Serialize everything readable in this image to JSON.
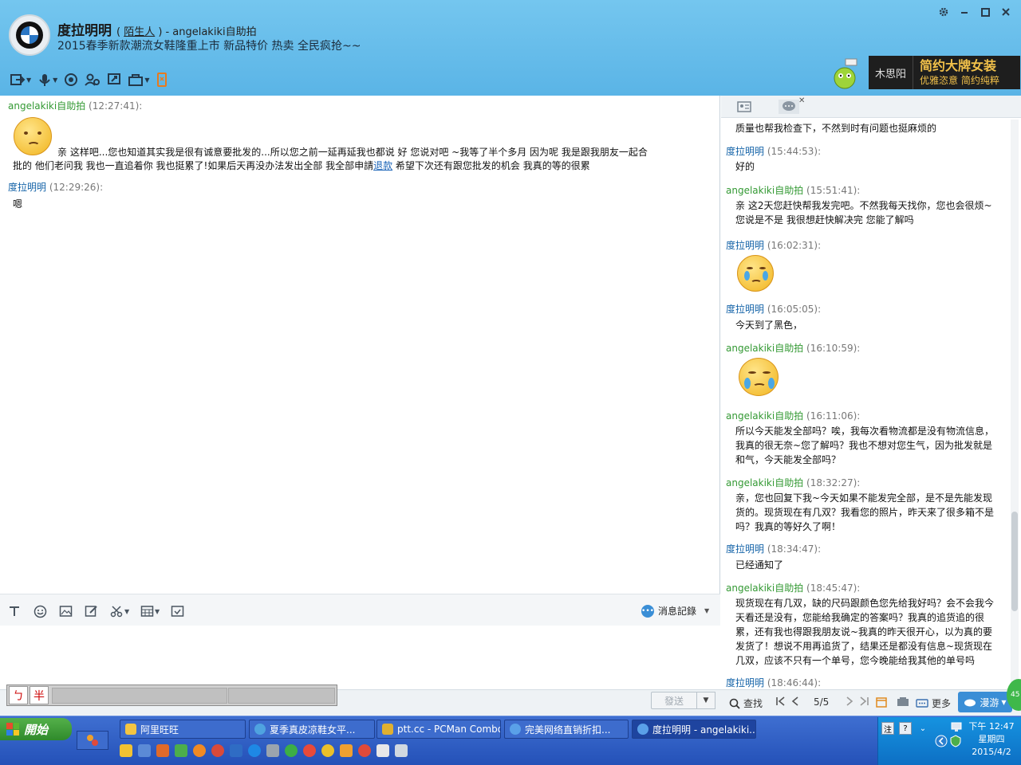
{
  "header": {
    "contact_name": "度拉明明",
    "stranger_label": "陌生人",
    "self_account": "- angelakiki自助拍",
    "signature": "2015春季新款潮流女鞋隆重上市 新品特价 热卖 全民疯抢~~",
    "window_controls": [
      "gear-icon",
      "minimize-icon",
      "maximize-icon",
      "close-icon"
    ],
    "ad_logo": "木思阳",
    "ad_line1": "简约大牌女装",
    "ad_line2": "优雅恣意 简约纯粹"
  },
  "chat": {
    "messages": [
      {
        "sender": "angelakiki自助拍",
        "time": "(12:27:41):",
        "line1": "亲  这样吧...您也知道其实我是很有诚意要批发的...所以您之前一延再延我也都说  好  您说对吧  ~我等了半个多月    因为呢  我是跟我朋友一起合",
        "line2a": "批的   他们老问我  我也一直追着你  我也挺累了!如果后天再没办法发出全部     我全部申請",
        "link": "退款",
        "line2b": "  希望下次还有跟您批发的机会   我真的等的很累"
      },
      {
        "sender": "度拉明明",
        "time": "(12:29:26):",
        "text": "嗯"
      }
    ]
  },
  "input": {
    "history_label": "消息記錄",
    "ime_char1": "ㄅ",
    "ime_char2": "半",
    "send_label": "發送"
  },
  "history_panel": {
    "entries": [
      {
        "text": "质量也帮我检查下，不然到时有问题也挺麻烦的"
      },
      {
        "sender": "度拉明明",
        "time": "(15:44:53):",
        "text": "好的"
      },
      {
        "sender": "angelakiki自助拍",
        "time": "(15:51:41):",
        "text": "亲  这2天您赶快帮我发完吧。不然我每天找你，您也会很烦~您说是不是    我很想赶快解决完  您能了解吗"
      },
      {
        "sender": "度拉明明",
        "time": "(16:02:31):"
      },
      {
        "sender": "度拉明明",
        "time": "(16:05:05):",
        "text": "今天到了黑色，"
      },
      {
        "sender": "angelakiki自助拍",
        "time": "(16:10:59):"
      },
      {
        "sender": "angelakiki自助拍",
        "time": "(16:11:06):",
        "text": "所以今天能发全部吗？唉，我每次看物流都是没有物流信息，我真的很无奈~您了解吗？我也不想对您生气，因为批发就是和气，今天能发全部吗？"
      },
      {
        "sender": "angelakiki自助拍",
        "time": "(18:32:27):",
        "text": "亲，您也回复下我~今天如果不能发完全部，是不是先能发现货的。现货现在有几双？我看您的照片，昨天来了很多箱不是吗？我真的等好久了啊！"
      },
      {
        "sender": "度拉明明",
        "time": "(18:34:47):",
        "text": "已经通知了"
      },
      {
        "sender": "angelakiki自助拍",
        "time": "(18:45:47):",
        "text": "现货现在有几双，缺的尺码跟颜色您先给我好吗？会不会我今天看还是没有，您能给我确定的答案吗？我真的追货追的很累，还有我也得跟我朋友说~我真的昨天很开心，以为真的要发货了！想说不用再追货了，结果还是都没有信息~现货现在几双，应该不只有一个单号，您今晚能给我其他的单号吗"
      },
      {
        "sender": "度拉明明",
        "time": "(18:46:44):"
      }
    ],
    "search_label": "查找",
    "page": "5/5",
    "more_label": "更多",
    "manyou_label": "漫游"
  },
  "taskbar": {
    "start_label": "開始",
    "items": [
      {
        "label": "阿里旺旺",
        "color": "#f4c542"
      },
      {
        "label": "夏季真皮凉鞋女平...",
        "color": "#4fa3e0"
      },
      {
        "label": "ptt.cc - PCMan Combo",
        "color": "#e0b030"
      },
      {
        "label": "完美网络直销折扣...",
        "color": "#5aa0e8"
      },
      {
        "label": "度拉明明 - angelakiki...",
        "color": "#5aa0e8"
      }
    ],
    "clock_time": "下午 12:47",
    "clock_day": "星期四",
    "clock_date": "2015/4/2",
    "badge": "45"
  },
  "colors": {
    "header_bg": "#5ab4e6",
    "green_name": "#339933",
    "blue_name": "#1463a8",
    "taskbar": "#2451b8"
  }
}
